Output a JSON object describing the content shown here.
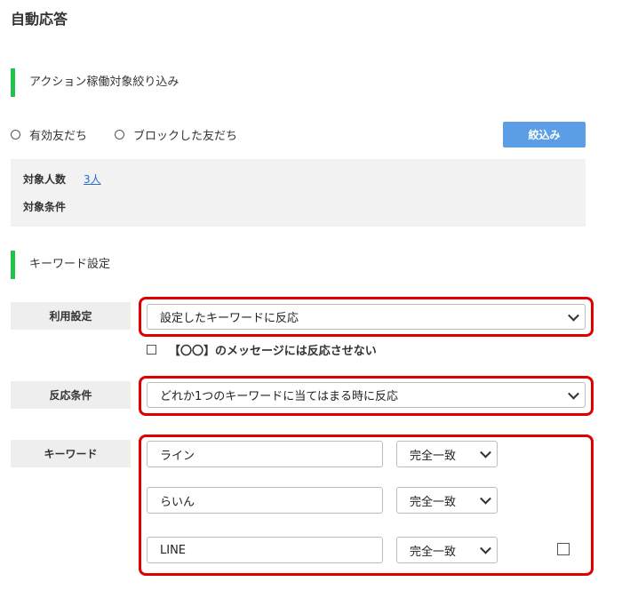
{
  "page": {
    "title": "自動応答"
  },
  "action_filter": {
    "heading": "アクション稼働対象絞り込み",
    "radio_active": "有効友だち",
    "radio_blocked": "ブロックした友だち",
    "filter_button": "絞込み",
    "target_count_label": "対象人数",
    "target_count_value": "3人",
    "target_condition_label": "対象条件"
  },
  "keyword_settings": {
    "heading": "キーワード設定",
    "usage_label": "利用設定",
    "usage_value": "設定したキーワードに反応",
    "ignore_checkbox_label": "【〇〇】のメッセージには反応させない",
    "condition_label": "反応条件",
    "condition_value": "どれか1つのキーワードに当てはまる時に反応",
    "keyword_label": "キーワード",
    "keywords": [
      {
        "value": "ライン",
        "match": "完全一致"
      },
      {
        "value": "らいん",
        "match": "完全一致"
      },
      {
        "value": "LINE",
        "match": "完全一致"
      }
    ]
  },
  "colors": {
    "accent_green": "#21c14a",
    "button_blue": "#5b9ee6",
    "highlight_red": "#e00000",
    "link_blue": "#2a6dc4"
  }
}
